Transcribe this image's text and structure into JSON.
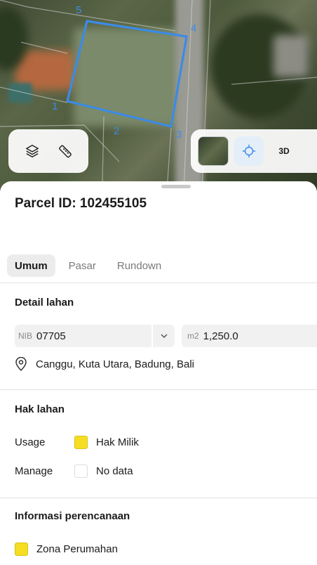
{
  "map": {
    "vertex_labels": [
      "5",
      "4",
      "1",
      "2",
      "3"
    ],
    "parcel_outline_color": "#3b8be6",
    "layers_icon": "layers-icon",
    "measure_icon": "ruler-icon",
    "locate_icon": "crosshair-icon",
    "view_3d_label": "3D"
  },
  "parcel": {
    "title": "Parcel ID: 102455105"
  },
  "tabs": [
    {
      "label": "Umum",
      "active": true
    },
    {
      "label": "Pasar",
      "active": false
    },
    {
      "label": "Rundown",
      "active": false
    }
  ],
  "detail": {
    "heading": "Detail lahan",
    "nib_prefix": "NIB",
    "nib_value": "07705",
    "area_prefix": "m2",
    "area_value": "1,250.0",
    "address": "Canggu, Kuta Utara, Badung, Bali"
  },
  "rights": {
    "heading": "Hak lahan",
    "usage_label": "Usage",
    "usage_value": "Hak Milik",
    "usage_color": "#f5de22",
    "manage_label": "Manage",
    "manage_value": "No data"
  },
  "planning": {
    "heading": "Informasi perencanaan",
    "zone_value": "Zona Perumahan",
    "zone_color": "#f5de22"
  }
}
